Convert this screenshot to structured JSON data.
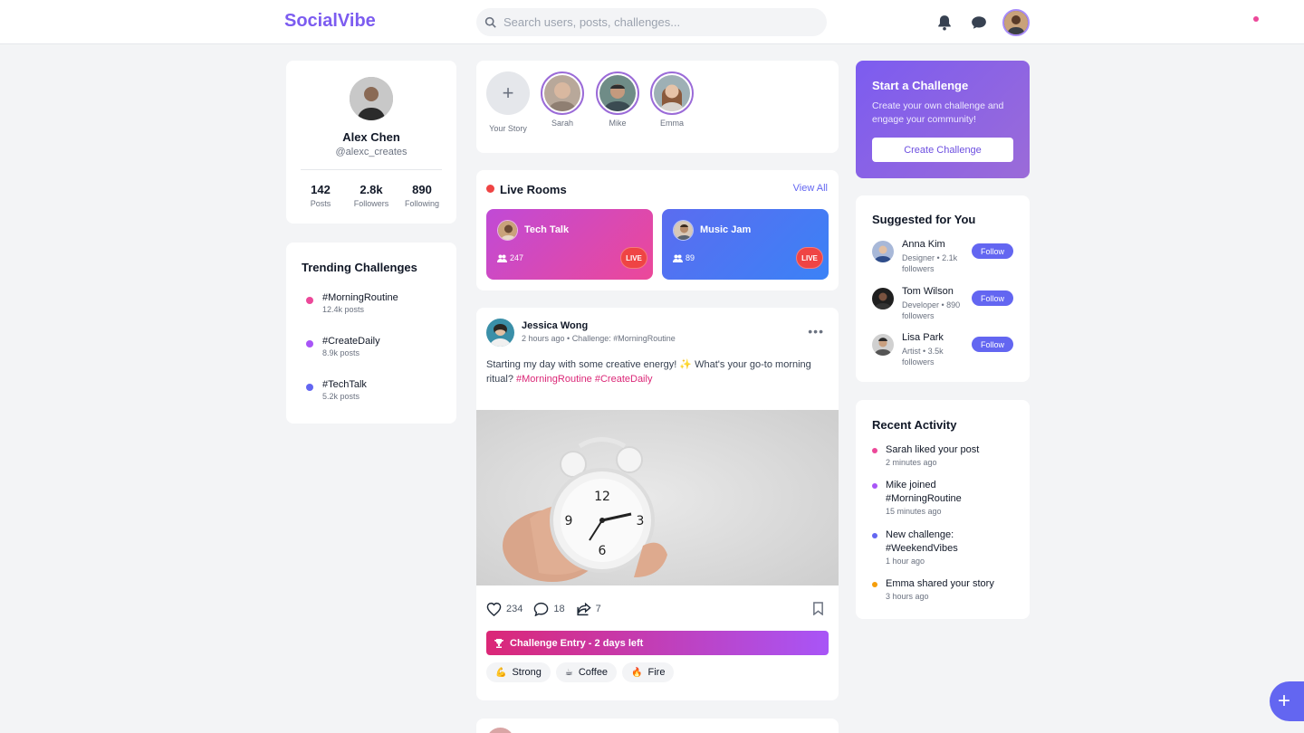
{
  "header": {
    "logo": "SocialVibe",
    "search_placeholder": "Search users, posts, challenges..."
  },
  "profile": {
    "name": "Alex Chen",
    "handle": "@alexc_creates",
    "stats": [
      {
        "value": "142",
        "label": "Posts"
      },
      {
        "value": "2.8k",
        "label": "Followers"
      },
      {
        "value": "890",
        "label": "Following"
      }
    ]
  },
  "trending": {
    "title": "Trending Challenges",
    "items": [
      {
        "tag": "#MorningRoutine",
        "count": "12.4k posts",
        "color": "#ec4899"
      },
      {
        "tag": "#CreateDaily",
        "count": "8.9k posts",
        "color": "#a855f7"
      },
      {
        "tag": "#TechTalk",
        "count": "5.2k posts",
        "color": "#6366f1"
      }
    ]
  },
  "stories": [
    {
      "name": "Your Story",
      "type": "add"
    },
    {
      "name": "Sarah"
    },
    {
      "name": "Mike"
    },
    {
      "name": "Emma"
    }
  ],
  "live_rooms": {
    "title": "Live Rooms",
    "view_all": "View All",
    "rooms": [
      {
        "title": "Tech Talk",
        "count": "247",
        "badge": "LIVE"
      },
      {
        "title": "Music Jam",
        "count": "89",
        "badge": "LIVE"
      }
    ]
  },
  "post": {
    "author": "Jessica Wong",
    "meta": "2 hours ago • Challenge: #MorningRoutine",
    "text": "Starting my day with some creative energy! ✨ What's your go-to morning ritual?",
    "tags": "#MorningRoutine #CreateDaily",
    "likes": "234",
    "comments": "18",
    "shares": "7",
    "challenge_banner": "Challenge Entry - 2 days left",
    "reactions": [
      {
        "emoji": "💪",
        "label": "Strong"
      },
      {
        "emoji": "☕",
        "label": "Coffee"
      },
      {
        "emoji": "🔥",
        "label": "Fire"
      }
    ]
  },
  "cta": {
    "title": "Start a Challenge",
    "description": "Create your own challenge and engage your community!",
    "button": "Create Challenge"
  },
  "suggested": {
    "title": "Suggested for You",
    "follow_label": "Follow",
    "users": [
      {
        "name": "Anna Kim",
        "info": "Designer • 2.1k followers"
      },
      {
        "name": "Tom Wilson",
        "info": "Developer • 890 followers"
      },
      {
        "name": "Lisa Park",
        "info": "Artist • 3.5k followers"
      }
    ]
  },
  "activity": {
    "title": "Recent Activity",
    "items": [
      {
        "text": "Sarah liked your post",
        "time": "2 minutes ago",
        "color": "#ec4899"
      },
      {
        "text": "Mike joined #MorningRoutine",
        "time": "15 minutes ago",
        "color": "#a855f7"
      },
      {
        "text": "New challenge: #WeekendVibes",
        "time": "1 hour ago",
        "color": "#6366f1"
      },
      {
        "text": "Emma shared your story",
        "time": "3 hours ago",
        "color": "#f59e0b"
      }
    ]
  },
  "fab_label": "+"
}
